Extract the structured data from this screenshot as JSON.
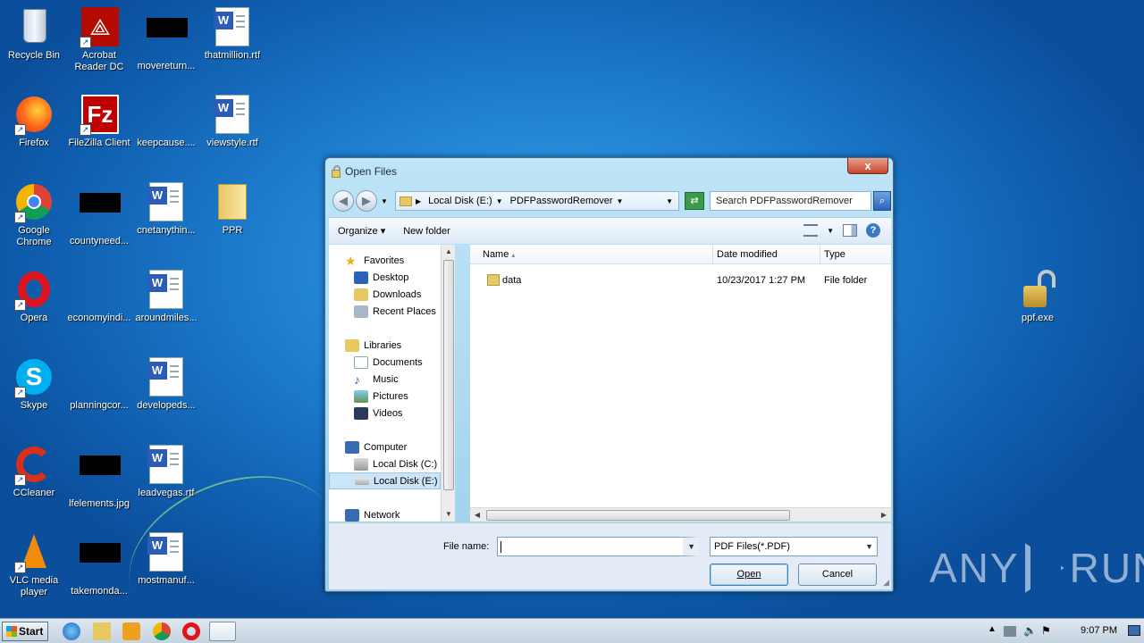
{
  "desktop": {
    "icons": [
      {
        "label": "Recycle Bin"
      },
      {
        "label": "Acrobat Reader DC"
      },
      {
        "label": "movereturn..."
      },
      {
        "label": "thatmillion.rtf"
      },
      {
        "label": "Firefox"
      },
      {
        "label": "FileZilla Client"
      },
      {
        "label": "keepcause...."
      },
      {
        "label": "viewstyle.rtf"
      },
      {
        "label": "Google Chrome"
      },
      {
        "label": "countyneed..."
      },
      {
        "label": "cnetanythin..."
      },
      {
        "label": "PPR"
      },
      {
        "label": "Opera"
      },
      {
        "label": "economyindi..."
      },
      {
        "label": "aroundmiles..."
      },
      {
        "label": "Skype"
      },
      {
        "label": "planningcor..."
      },
      {
        "label": "developeds..."
      },
      {
        "label": "CCleaner"
      },
      {
        "label": "lfelements.jpg"
      },
      {
        "label": "leadvegas.rtf"
      },
      {
        "label": "VLC media player"
      },
      {
        "label": "takemonda..."
      },
      {
        "label": "mostmanuf..."
      },
      {
        "label": "ppf.exe"
      }
    ]
  },
  "dialog": {
    "title": "Open Files",
    "close_label": "x",
    "address": {
      "segments": [
        "Local Disk (E:)",
        "PDFPasswordRemover"
      ]
    },
    "search_placeholder": "Search PDFPasswordRemover",
    "toolbar": {
      "organize": "Organize",
      "new_folder": "New folder"
    },
    "nav": {
      "favorites": "Favorites",
      "desktop": "Desktop",
      "downloads": "Downloads",
      "recent": "Recent Places",
      "libraries": "Libraries",
      "documents": "Documents",
      "music": "Music",
      "pictures": "Pictures",
      "videos": "Videos",
      "computer": "Computer",
      "disk_c": "Local Disk (C:)",
      "disk_e": "Local Disk (E:)",
      "network": "Network"
    },
    "columns": {
      "name": "Name",
      "date": "Date modified",
      "type": "Type"
    },
    "rows": [
      {
        "name": "data",
        "date": "10/23/2017 1:27 PM",
        "type": "File folder"
      }
    ],
    "file_name_label": "File name:",
    "file_name_value": "",
    "file_type": "PDF Files(*.PDF)",
    "open_label": "Open",
    "cancel_label": "Cancel"
  },
  "taskbar": {
    "start_label": "Start",
    "clock": "9:07 PM"
  },
  "watermark": {
    "left": "ANY",
    "right": "RUN"
  },
  "colors": {
    "desktop_bg": "#1f7fd0",
    "dialog_frame": "#9fd0ec",
    "selection": "#cce4f7"
  }
}
